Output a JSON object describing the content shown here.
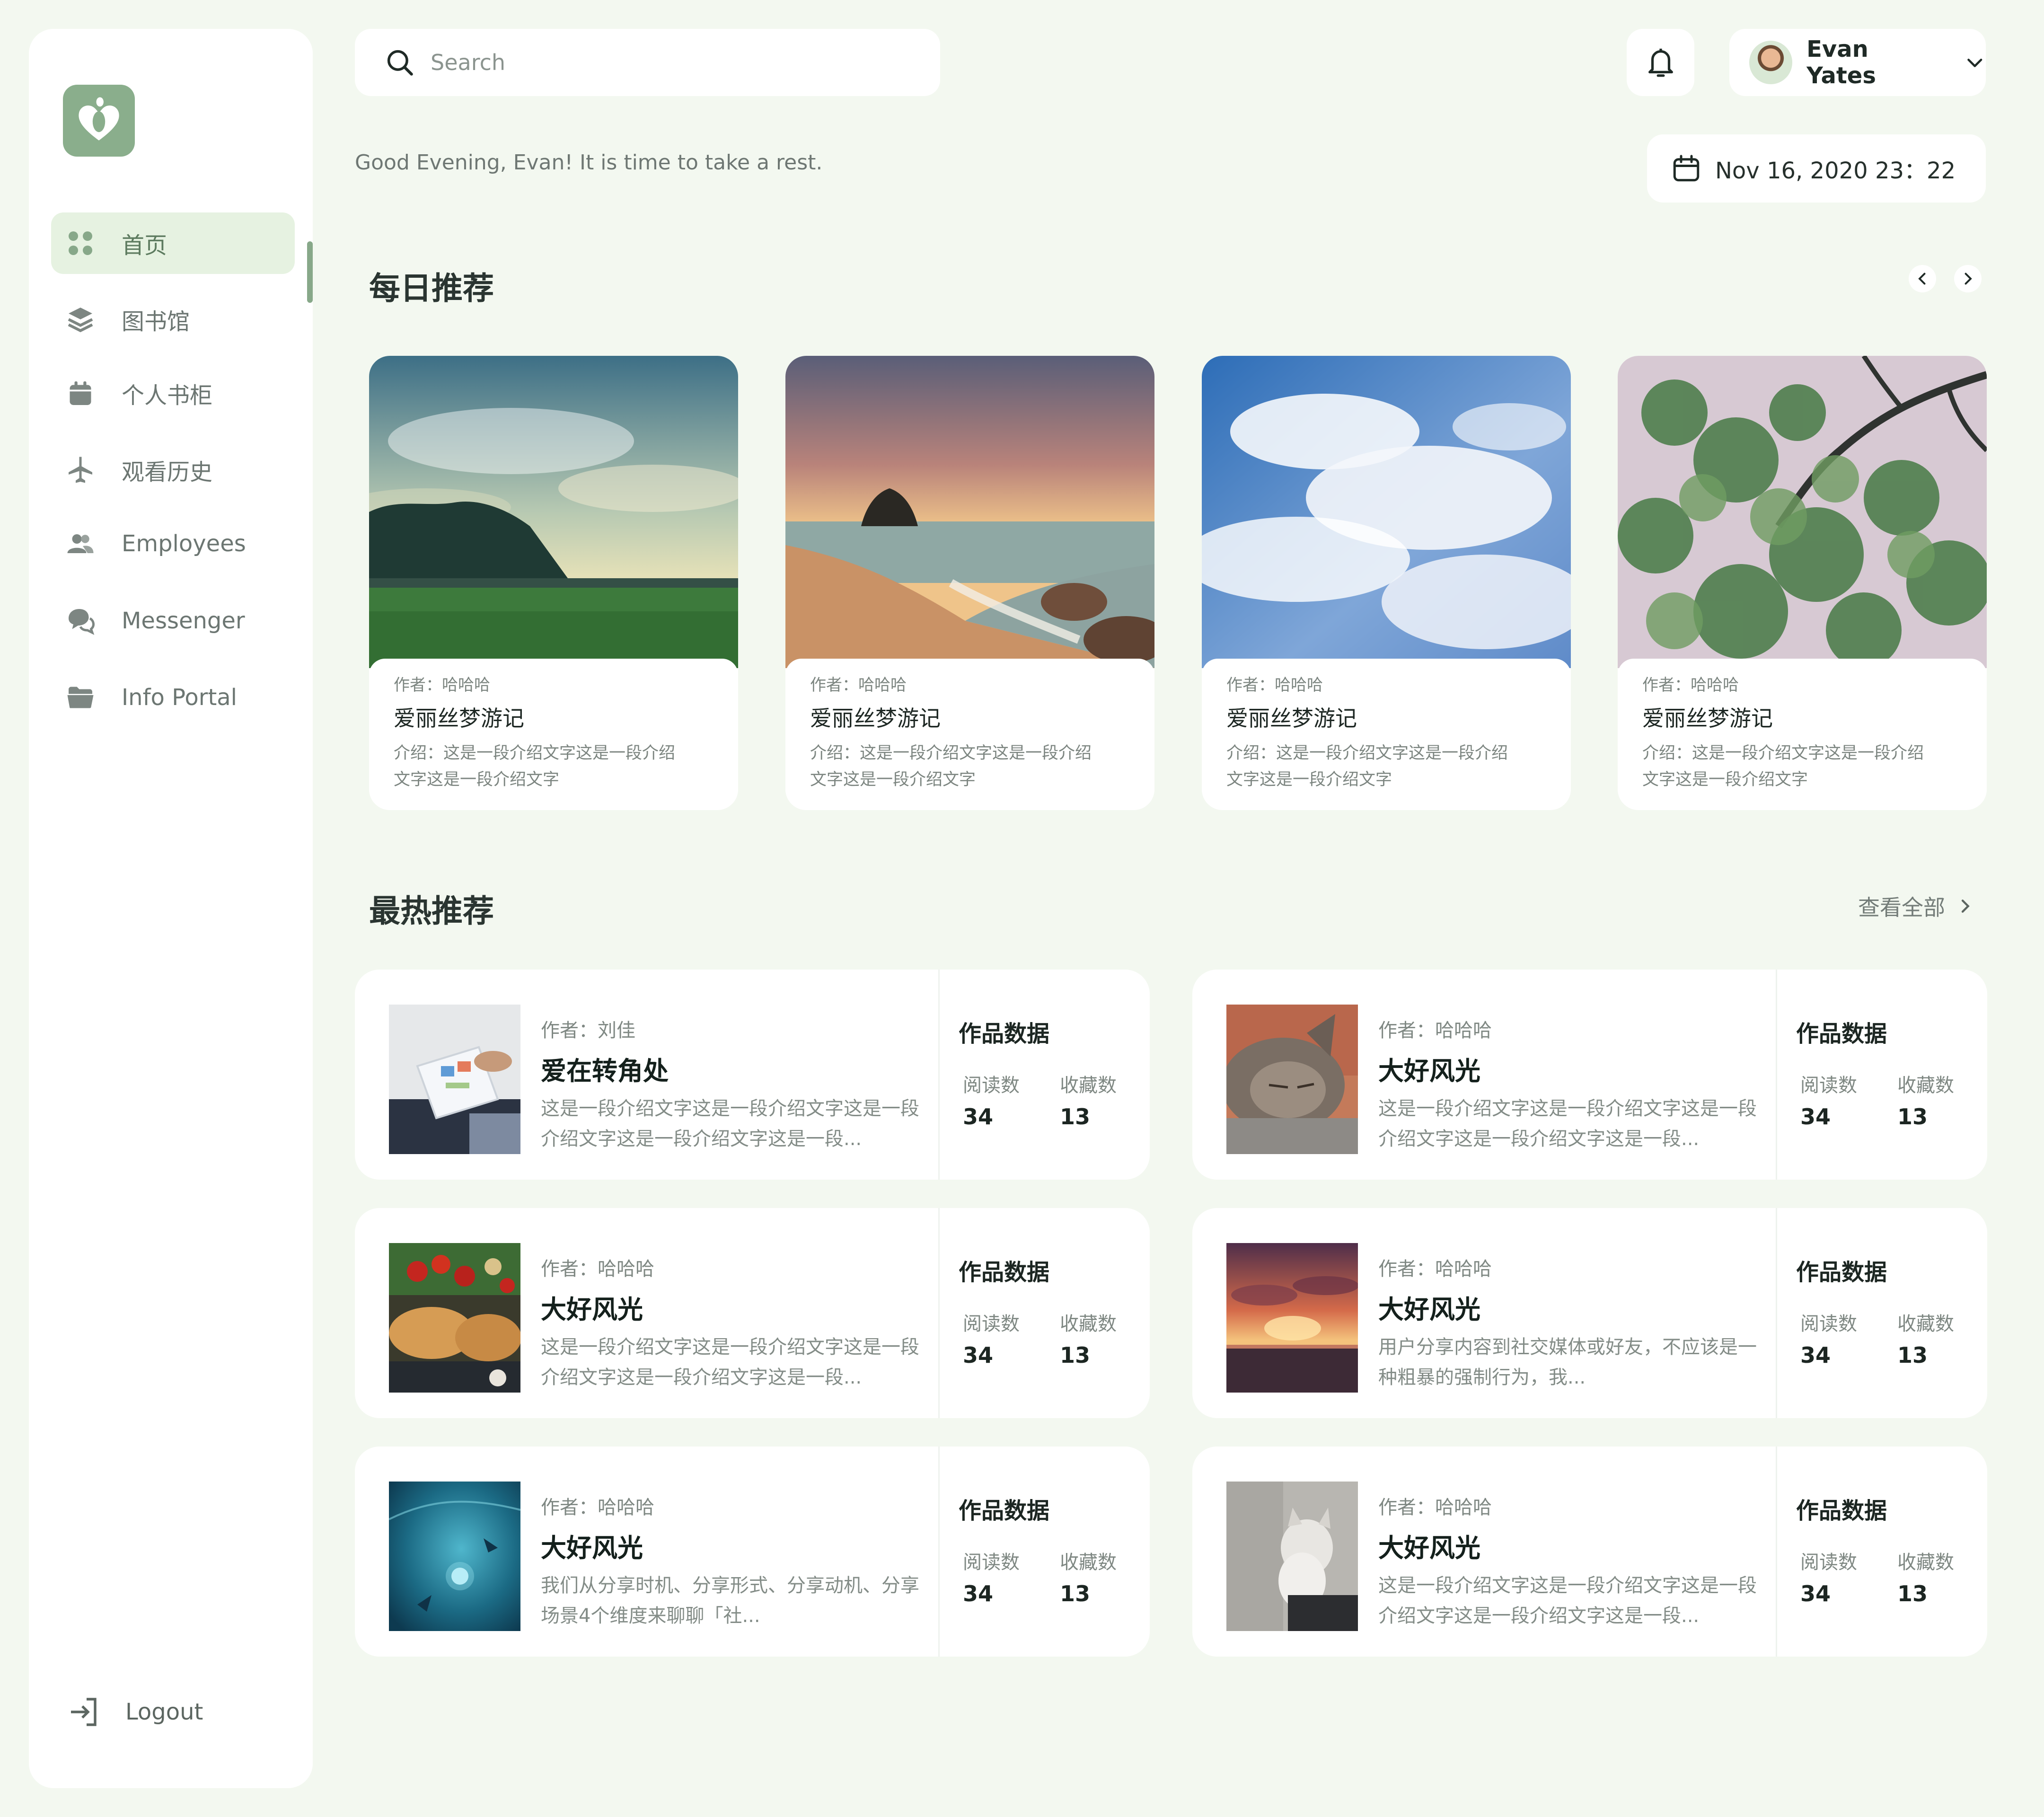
{
  "sidebar": {
    "items": [
      {
        "label": "首页",
        "icon": "dashboard-icon",
        "active": true
      },
      {
        "label": "图书馆",
        "icon": "layers-icon"
      },
      {
        "label": "个人书柜",
        "icon": "calendar-icon"
      },
      {
        "label": "观看历史",
        "icon": "airplane-icon"
      },
      {
        "label": "Employees",
        "icon": "users-icon"
      },
      {
        "label": "Messenger",
        "icon": "chat-icon"
      },
      {
        "label": "Info Portal",
        "icon": "folder-icon"
      }
    ],
    "logout_label": "Logout"
  },
  "header": {
    "search_placeholder": "Search",
    "user_name": "Evan Yates",
    "greeting": "Good Evening, Evan! It is time to take a rest.",
    "datetime": "Nov 16, 2020 23：22"
  },
  "daily": {
    "title": "每日推荐",
    "cards": [
      {
        "author": "作者：哈哈哈",
        "title": "爱丽丝梦游记",
        "desc": "介绍：这是一段介绍文字这是一段介绍文字这是一段介绍文字"
      },
      {
        "author": "作者：哈哈哈",
        "title": "爱丽丝梦游记",
        "desc": "介绍：这是一段介绍文字这是一段介绍文字这是一段介绍文字"
      },
      {
        "author": "作者：哈哈哈",
        "title": "爱丽丝梦游记",
        "desc": "介绍：这是一段介绍文字这是一段介绍文字这是一段介绍文字"
      },
      {
        "author": "作者：哈哈哈",
        "title": "爱丽丝梦游记",
        "desc": "介绍：这是一段介绍文字这是一段介绍文字这是一段介绍文字"
      }
    ]
  },
  "hot": {
    "title": "最热推荐",
    "view_all": "查看全部",
    "stats_title": "作品数据",
    "read_label": "阅读数",
    "fav_label": "收藏数",
    "cards": [
      {
        "author": "作者：刘佳",
        "title": "爱在转角处",
        "desc": "这是一段介绍文字这是一段介绍文字这是一段介绍文字这是一段介绍文字这是一段...",
        "reads": "34",
        "favs": "13"
      },
      {
        "author": "作者：哈哈哈",
        "title": "大好风光",
        "desc": "这是一段介绍文字这是一段介绍文字这是一段介绍文字这是一段介绍文字这是一段...",
        "reads": "34",
        "favs": "13"
      },
      {
        "author": "作者：哈哈哈",
        "title": "大好风光",
        "desc": "这是一段介绍文字这是一段介绍文字这是一段介绍文字这是一段介绍文字这是一段...",
        "reads": "34",
        "favs": "13"
      },
      {
        "author": "作者：哈哈哈",
        "title": "大好风光",
        "desc": "用户分享内容到社交媒体或好友，不应该是一种粗暴的强制行为，我...",
        "reads": "34",
        "favs": "13"
      },
      {
        "author": "作者：哈哈哈",
        "title": "大好风光",
        "desc": "我们从分享时机、分享形式、分享动机、分享场景4个维度来聊聊「社...",
        "reads": "34",
        "favs": "13"
      },
      {
        "author": "作者：哈哈哈",
        "title": "大好风光",
        "desc": "这是一段介绍文字这是一段介绍文字这是一段介绍文字这是一段介绍文字这是一段...",
        "reads": "34",
        "favs": "13"
      }
    ]
  },
  "colors": {
    "background": "#f3f8f0",
    "accent": "#8aae8c",
    "active_bg": "#e6f2e1"
  }
}
